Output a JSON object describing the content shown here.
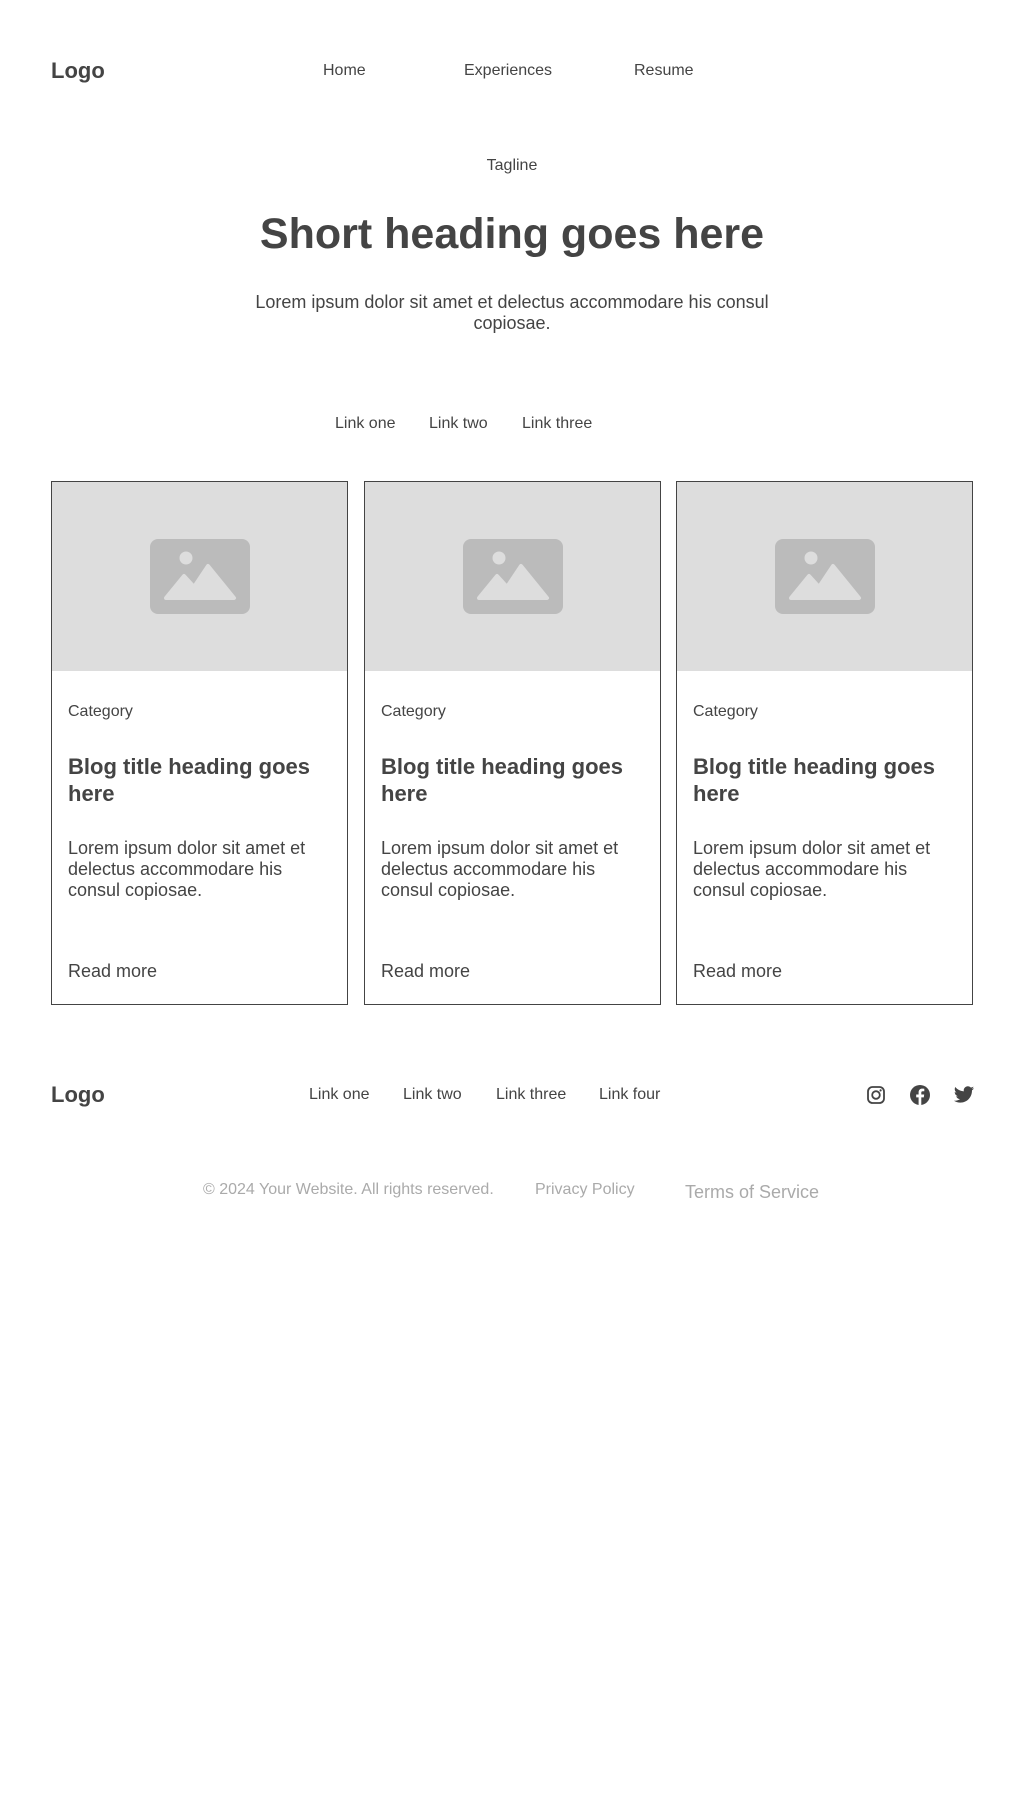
{
  "header": {
    "logo": "Logo",
    "nav": [
      "Home",
      "Experiences",
      "Resume"
    ]
  },
  "hero": {
    "tagline": "Tagline",
    "title": "Short heading goes here",
    "description": "Lorem ipsum dolor sit amet et delectus accommodare his consul copiosae."
  },
  "tabs": [
    "Link one",
    "Link two",
    "Link three"
  ],
  "cards": [
    {
      "image_icon": "image-placeholder-icon",
      "category": "Category",
      "title": "Blog title heading goes here",
      "description": "Lorem ipsum dolor sit amet et delectus accommodare his consul copiosae.",
      "link": "Read more"
    },
    {
      "image_icon": "image-placeholder-icon",
      "category": "Category",
      "title": "Blog title heading goes here",
      "description": "Lorem ipsum dolor sit amet et delectus accommodare his consul copiosae.",
      "link": "Read more"
    },
    {
      "image_icon": "image-placeholder-icon",
      "category": "Category",
      "title": "Blog title heading goes here",
      "description": "Lorem ipsum dolor sit amet et delectus accommodare his consul copiosae.",
      "link": "Read more"
    }
  ],
  "footer": {
    "logo": "Logo",
    "links": [
      "Link one",
      "Link two",
      "Link three",
      "Link four"
    ],
    "social_icons": [
      "instagram-icon",
      "facebook-icon",
      "twitter-icon"
    ]
  },
  "legal": {
    "copyright": "© 2024 Your Website. All rights reserved.",
    "privacy": "Privacy Policy",
    "terms": "Terms of Service"
  },
  "colors": {
    "text": "#444444",
    "muted": "#aaaaaa",
    "placeholder_bg": "#dddddd",
    "placeholder_icon": "#bbbbbb",
    "border": "#444444"
  }
}
